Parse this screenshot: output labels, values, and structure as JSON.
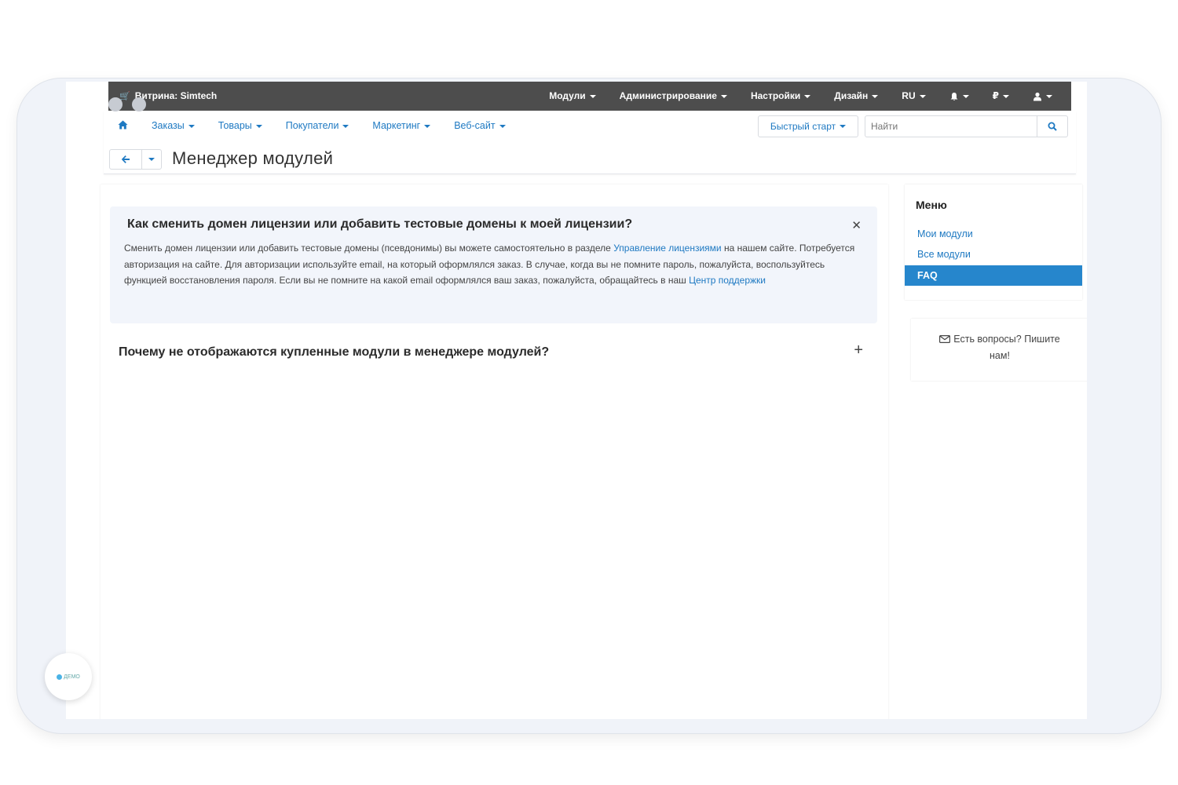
{
  "topbar": {
    "store": "Витрина: Simtech",
    "nav": [
      "Модули",
      "Администрирование",
      "Настройки",
      "Дизайн",
      "RU"
    ],
    "currency": "₽"
  },
  "subnav": {
    "items": [
      "Заказы",
      "Товары",
      "Покупатели",
      "Маркетинг",
      "Веб-сайт"
    ],
    "quick_start": "Быстрый старт",
    "search_placeholder": "Найти"
  },
  "page": {
    "title": "Менеджер модулей"
  },
  "faq": [
    {
      "question": "Как сменить домен лицензии или добавить тестовые домены к моей лицензии?",
      "answer_part1": "Сменить домен лицензии или добавить тестовые домены (псевдонимы) вы можете самостоятельно в разделе ",
      "answer_link1": "Управление лицензиями",
      "answer_part2": " на нашем сайте. Потребуется авторизация на сайте. Для авторизации используйте email, на который оформлялся заказ. В случае, когда вы не помните пароль, пожалуйста, воспользуйтесь функцией восстановления пароля. Если вы не помните на какой email оформлялся ваш заказ, пожалуйста, обращайтесь в наш ",
      "answer_link2": "Центр поддержки"
    },
    {
      "question": "Почему не отображаются купленные модули в менеджере модулей?"
    }
  ],
  "sidebar": {
    "title": "Меню",
    "items": [
      "Мои модули",
      "Все модули",
      "FAQ"
    ],
    "contact": "Есть вопросы? Пишите нам!"
  },
  "demo_badge": "ДЕМО",
  "colors": {
    "topbar": "#4d4d4d",
    "link": "#1e79c2",
    "active": "#2686cc"
  }
}
